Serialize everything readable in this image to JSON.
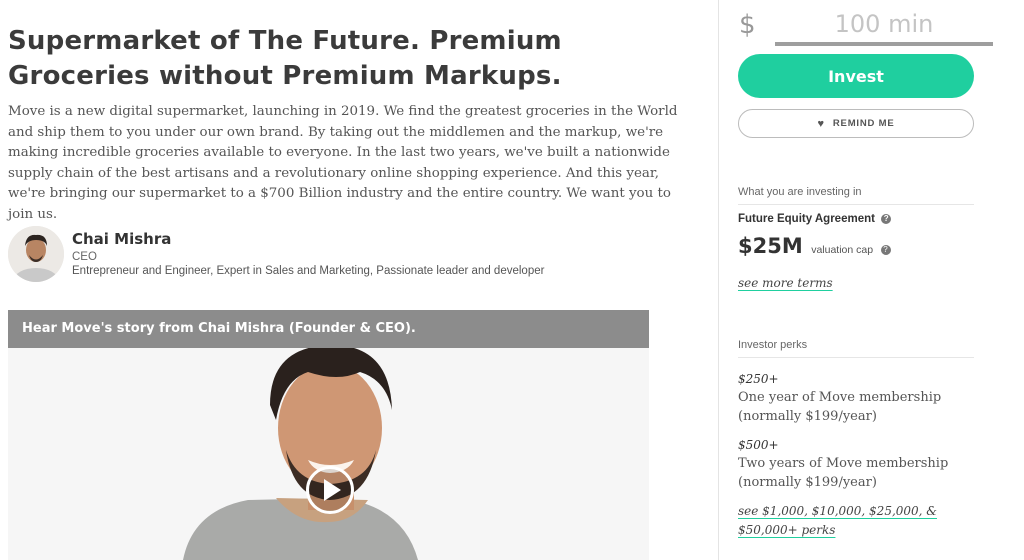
{
  "main": {
    "headline": "Supermarket of The Future. Premium Groceries without Premium Markups.",
    "description": "Move is a new digital supermarket, launching in 2019. We find the greatest groceries in the World and ship them to you under our own brand. By taking out the middlemen and the markup, we're making incredible groceries available to everyone. In the last two years, we've built a nationwide supply chain of the best artisans and a revolutionary online shopping experience. And this year, we're bringing our supermarket to a $700 Billion industry and the entire country. We want you to join us.",
    "founder": {
      "name": "Chai Mishra",
      "role": "CEO",
      "bio": "Entrepreneur and Engineer, Expert in Sales and Marketing, Passionate leader and developer"
    },
    "video": {
      "caption": "Hear Move's story from Chai Mishra (Founder & CEO).",
      "play_icon": "play-icon"
    }
  },
  "sidebar": {
    "currency_symbol": "$",
    "amount_placeholder": "100 min",
    "invest_label": "Invest",
    "remind_label": "REMIND ME",
    "remind_icon": "heart-icon",
    "investing_heading": "What you are investing in",
    "instrument": "Future Equity Agreement",
    "valuation_amount": "$25M",
    "valuation_caption": "valuation cap",
    "terms_link": "see more terms",
    "perks_heading": "Investor perks",
    "perks": [
      {
        "amount": "$250+",
        "description": "One year of Move membership (normally $199/year)"
      },
      {
        "amount": "$500+",
        "description": "Two years of Move membership (normally $199/year)"
      }
    ],
    "more_perks_link": "see $1,000, $10,000, $25,000, & $50,000+ perks"
  },
  "colors": {
    "accent": "#1fcf9f",
    "video_bar": "#8c8c8c"
  }
}
